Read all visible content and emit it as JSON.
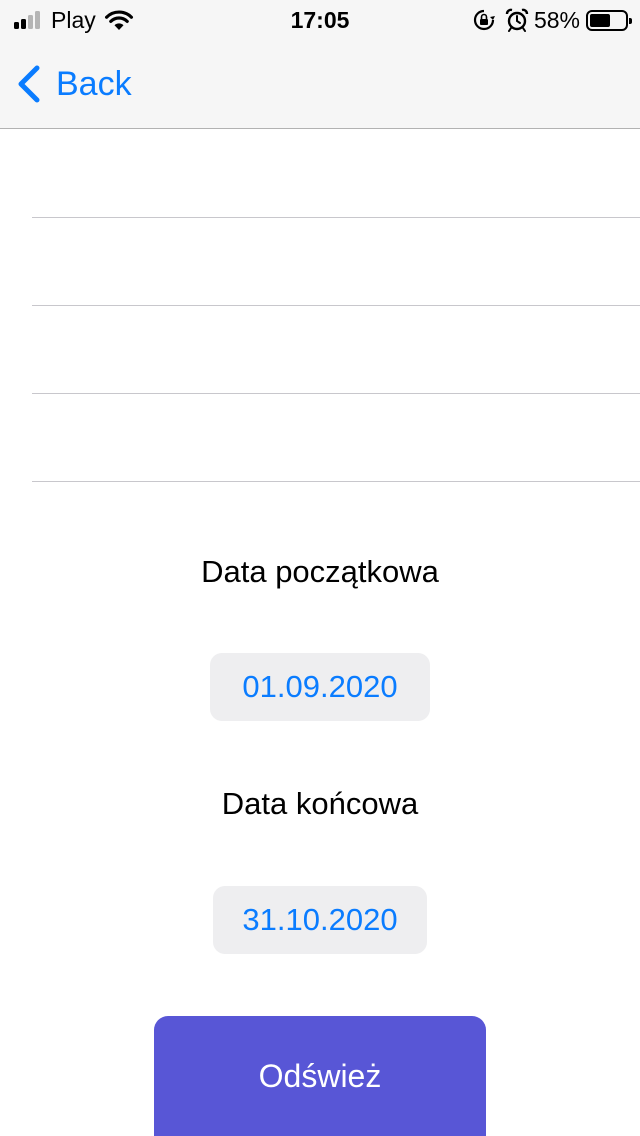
{
  "status_bar": {
    "carrier": "Play",
    "time": "17:05",
    "battery_percent": "58%",
    "battery_level": 0.58,
    "icons": [
      "signal-icon",
      "wifi-icon",
      "orientation-lock-icon",
      "alarm-icon",
      "battery-icon"
    ]
  },
  "nav": {
    "back_label": "Back",
    "back_icon": "chevron-left-icon"
  },
  "table": {
    "rows": [
      "",
      "",
      "",
      ""
    ]
  },
  "form": {
    "start_label": "Data początkowa",
    "start_date": "01.09.2020",
    "end_label": "Data końcowa",
    "end_date": "31.10.2020",
    "refresh_label": "Odśwież"
  },
  "colors": {
    "accent": "#0a7cff",
    "button": "#5856d6",
    "pill_bg": "#eeeef0",
    "bar_bg": "#f6f6f6"
  }
}
